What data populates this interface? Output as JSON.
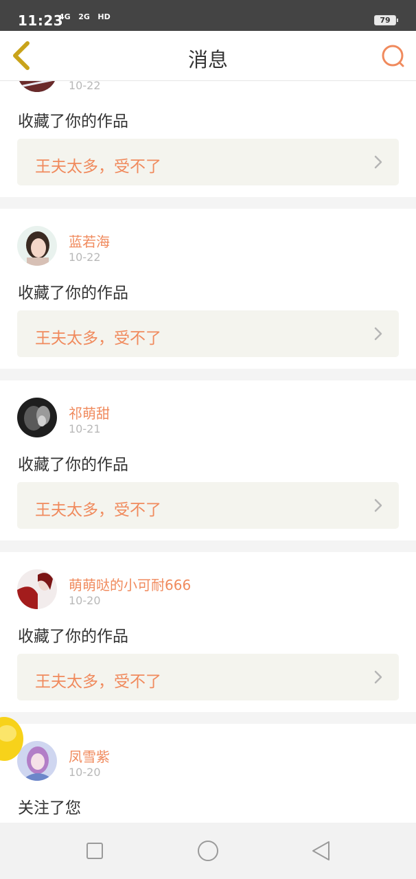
{
  "status_bar": {
    "time": "11:23",
    "signal_1": "4G",
    "signal_2": "2G",
    "network": "HD",
    "battery": "79"
  },
  "header": {
    "title": "消息",
    "back_icon": "chevron-left-icon",
    "search_icon": "search-icon"
  },
  "messages": [
    {
      "user": "",
      "date": "10-22",
      "action": "收藏了你的作品",
      "work": "王夫太多，受不了"
    },
    {
      "user": "蓝若海",
      "date": "10-22",
      "action": "收藏了你的作品",
      "work": "王夫太多，受不了"
    },
    {
      "user": "祁萌甜",
      "date": "10-21",
      "action": "收藏了你的作品",
      "work": "王夫太多，受不了"
    },
    {
      "user": "萌萌哒的小可耐666",
      "date": "10-20",
      "action": "收藏了你的作品",
      "work": "王夫太多，受不了"
    },
    {
      "user": "凤雪紫",
      "date": "10-20",
      "action": "关注了您",
      "work": ""
    }
  ],
  "nav_bar": {
    "recents_icon": "square-icon",
    "home_icon": "circle-icon",
    "back_icon": "triangle-back-icon"
  },
  "colors": {
    "accent": "#f08a5d",
    "back_arrow": "#c9a31a",
    "text": "#333333",
    "muted": "#b8b8b8",
    "card_link_bg": "#f4f4ee",
    "status_bar": "#444444"
  }
}
